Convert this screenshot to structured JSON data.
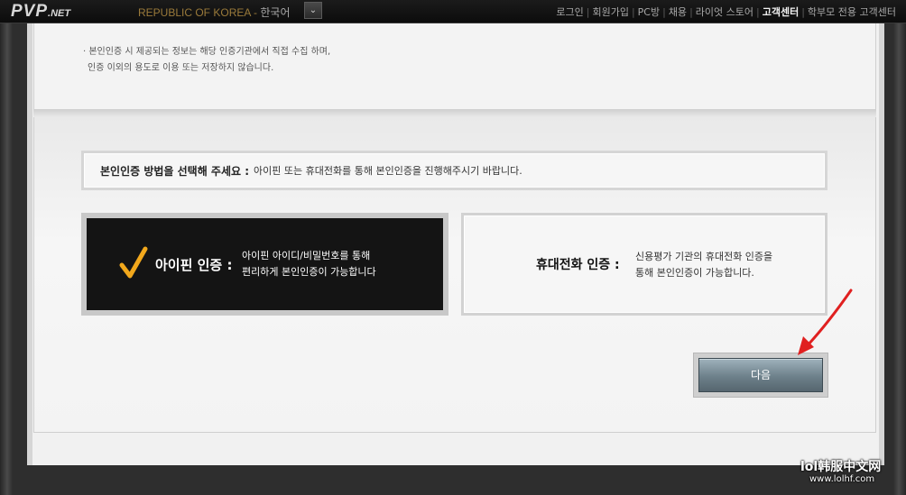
{
  "topbar": {
    "logo": "PVP",
    "logo_suffix": ".NET",
    "region": "REPUBLIC OF KOREA",
    "language": "한국어",
    "language_dropdown": "⌄",
    "nav": [
      "로그인",
      "회원가입",
      "PC방",
      "채용",
      "라이엇 스토어",
      "고객센터",
      "학부모 전용 고객센터"
    ],
    "active_nav": "고객센터"
  },
  "notice": {
    "line1": "· 본인인증 시 제공되는 정보는 해당 인증기관에서 직접 수집 하며,",
    "line2": "인증 이외의 용도로 이용 또는 저장하지 않습니다."
  },
  "instruction": {
    "label": "본인인증 방법을 선택해 주세요 :",
    "text": "아이핀 또는 휴대전화를 통해 본인인증을 진행해주시기 바랍니다."
  },
  "options": {
    "ipin": {
      "title": "아이핀 인증 :",
      "desc_line1": "아이핀 아이디/비밀번호를 통해",
      "desc_line2": "편리하게 본인인증이 가능합니다",
      "selected": true,
      "check_icon": "check-icon"
    },
    "phone": {
      "title": "휴대전화 인증 :",
      "desc_line1": "신용평가 기관의 휴대전화 인증을",
      "desc_line2": "통해 본인인증이 가능합니다.",
      "selected": false
    }
  },
  "next_button": "다음",
  "watermark": {
    "line1": "lol韩服中文网",
    "line2": "www.lolhf.com"
  },
  "colors": {
    "check": "#f2a81c",
    "arrow": "#e02020",
    "selected_bg": "#141414"
  }
}
